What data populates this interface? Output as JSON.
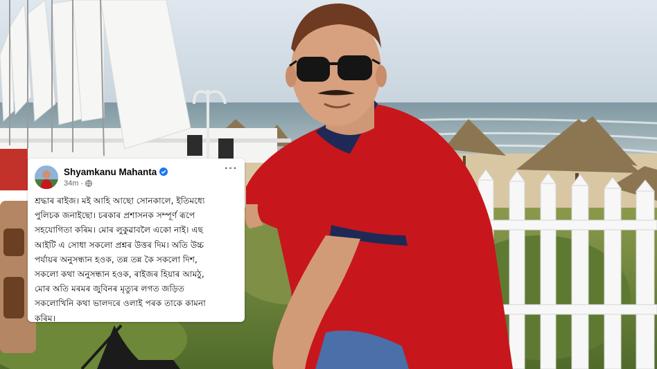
{
  "post": {
    "author": "Shyamkanu Mahanta",
    "time": "34m",
    "separator": "·",
    "more": "···",
    "text": "শ্ৰদ্ধাৰ ৰাইজ। মই আহি আছো সোনকালে, ইতিমধ্যে\nপুলিচক জনাইছো। চৰকাৰ প্ৰশাসনক সম্পূৰ্ণ ৰূপে\nসহযোগিতা কৰিম। মোৰ লুকুৱাবলৈ একো নাই। এছ\nআইটি এ সোধা সকলো প্ৰশ্নৰ উত্তৰ দিম। অতি উচ্চ\nপৰ্যায়ৰ অনুসন্ধান হওক, তন্ন তন্ন কৈ সকলো দিশ,\nসকলো কথা অনুসন্ধান হওক, ৰাইজৰ হিয়াৰ আমঠু,\nমোৰ অতি মৰমৰ জুবিনৰ মৃত্যুৰ লগত জড়িত\nসকলোখিনি কথা ভালদৰে ওলাই পৰক তাকে কামনা\nকৰিম।"
  },
  "icons": {
    "verified": "verified-badge-icon",
    "audience": "globe-icon",
    "more": "more-options-icon"
  },
  "colors": {
    "shirt": "#c8161d",
    "verified": "#1877f2",
    "sea": "#9fb6bd",
    "sky": "#dfe7ee"
  }
}
